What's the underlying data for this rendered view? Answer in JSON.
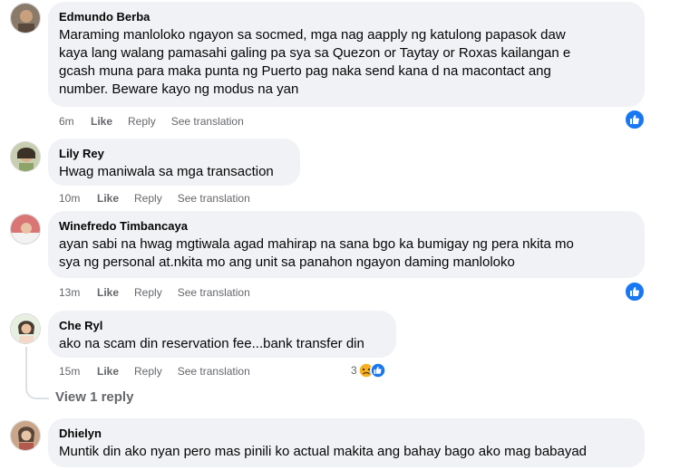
{
  "comments": [
    {
      "name": "Edmundo Berba",
      "lines": [
        "Maraming manloloko ngayon sa socmed, mga nag aapply ng katulong papasok daw",
        "kaya lang walang pamasahi galing pa sya sa Quezon or Taytay or Roxas kailangan e",
        "gcash muna para maka punta ng Puerto pag naka send kana d na macontact ang",
        "number. Beware kayo ng modus na yan"
      ],
      "time": "6m",
      "like": "Like",
      "reply": "Reply",
      "translate": "See translation",
      "reaction": "like"
    },
    {
      "name": "Lily Rey",
      "lines": [
        "Hwag maniwala sa mga transaction"
      ],
      "time": "10m",
      "like": "Like",
      "reply": "Reply",
      "translate": "See translation"
    },
    {
      "name": "Winefredo Timbancaya",
      "lines": [
        "ayan sabi na hwag mgtiwala agad mahirap na sana bgo ka bumigay ng pera nkita mo",
        "sya ng personal at.nkita mo ang unit sa panahon ngayon daming manloloko"
      ],
      "time": "13m",
      "like": "Like",
      "reply": "Reply",
      "translate": "See translation",
      "reaction": "like"
    },
    {
      "name": "Che Ryl",
      "lines": [
        "ako na scam din reservation fee...bank transfer din"
      ],
      "time": "15m",
      "like": "Like",
      "reply": "Reply",
      "translate": "See translation",
      "reaction_count": "3",
      "view_replies": "View 1 reply"
    },
    {
      "name": "Dhielyn",
      "lines": [
        "Muntik din ako nyan pero mas pinili ko actual makita ang bahay bago ako mag babayad"
      ]
    }
  ],
  "colors": {
    "bubble": "#f0f2f5",
    "meta_text": "#65676b",
    "like_blue": "#1877f2",
    "haha_yellow": "#f7b125"
  }
}
